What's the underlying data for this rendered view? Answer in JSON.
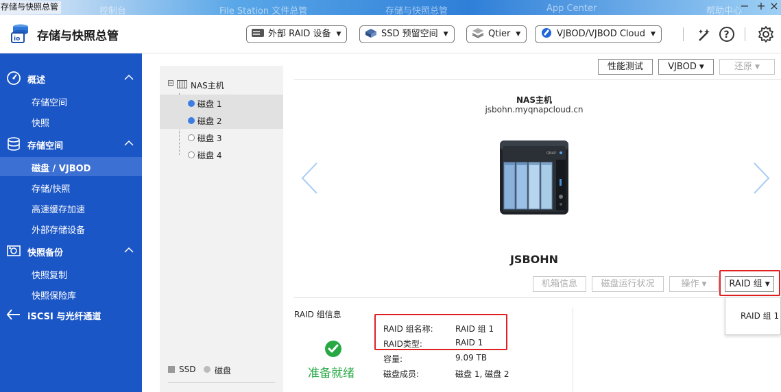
{
  "window": {
    "title": "存储与快照总管",
    "ghost_tabs": [
      "控制台",
      "File Station 文件总管",
      "存储与快照总管",
      "App Center",
      "帮助中心"
    ],
    "minimize": "−",
    "maximize": "+",
    "close": "×"
  },
  "header": {
    "app_title": "存储与快照总管",
    "buttons": [
      {
        "label": "外部 RAID 设备",
        "icon": "external-raid-icon"
      },
      {
        "label": "SSD 预留空间",
        "icon": "ssd-provision-icon"
      },
      {
        "label": "Qtier",
        "icon": "qtier-icon"
      },
      {
        "label": "VJBOD/VJBOD Cloud",
        "icon": "vjbod-cloud-icon"
      }
    ]
  },
  "sidebar": {
    "sections": [
      {
        "label": "概述",
        "icon": "dashboard-icon",
        "items": [
          "存储空间",
          "快照"
        ]
      },
      {
        "label": "存储空间",
        "icon": "database-icon",
        "items": [
          "磁盘 / VJBOD",
          "存储/快照",
          "高速缓存加速",
          "外部存储设备"
        ]
      },
      {
        "label": "快照备份",
        "icon": "snapshot-icon",
        "items": [
          "快照复制",
          "快照保险库"
        ]
      },
      {
        "label": "iSCSI 与光纤通道",
        "icon": "iscsi-icon",
        "items": []
      }
    ],
    "active_item": "磁盘 / VJBOD"
  },
  "tree": {
    "root": "NAS主机",
    "disks": [
      {
        "label": "磁盘 1",
        "selected": true
      },
      {
        "label": "磁盘 2",
        "selected": true
      },
      {
        "label": "磁盘 3",
        "selected": false
      },
      {
        "label": "磁盘 4",
        "selected": false
      }
    ],
    "legend": {
      "ssd": "SSD",
      "disk": "磁盘"
    }
  },
  "toolbar": {
    "perf_test": "性能测试",
    "vjbod": "VJBOD",
    "restore": "还原"
  },
  "device": {
    "name": "NAS主机",
    "host": "jsbohn.myqnapcloud.cn",
    "title": "JSBOHN"
  },
  "actions": {
    "enclosure_info": "机箱信息",
    "disk_health": "磁盘运行状况",
    "operation": "操作",
    "raid_group": "RAID 组",
    "raid_menu_item": "RAID 组 1"
  },
  "raid_info": {
    "section_title": "RAID 组信息",
    "status": "准备就绪",
    "rows": [
      {
        "key": "RAID 组名称:",
        "value": "RAID 组 1"
      },
      {
        "key": "RAID类型:",
        "value": "RAID 1"
      },
      {
        "key": "容量:",
        "value": "9.09 TB"
      },
      {
        "key": "磁盘成员:",
        "value": "磁盘 1, 磁盘 2"
      }
    ]
  },
  "colors": {
    "sidebar": "#1b56c6",
    "sidebar_active": "#3d70d3",
    "highlight_red": "#e02020",
    "ready_green": "#27a844",
    "disk_blue": "#3b7de3"
  }
}
